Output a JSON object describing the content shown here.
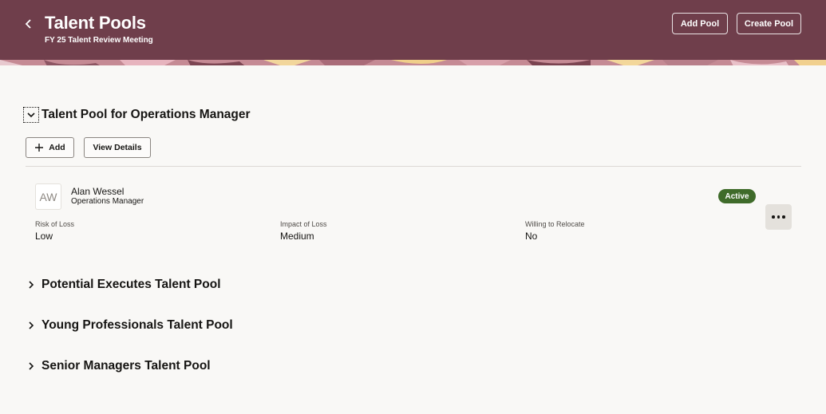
{
  "header": {
    "title": "Talent Pools",
    "subtitle": "FY 25 Talent Review Meeting",
    "add_pool_label": "Add Pool",
    "create_pool_label": "Create Pool",
    "back_icon": "chevron-left-icon",
    "background_color": "#6f3e4b"
  },
  "expanded_pool": {
    "title": "Talent Pool for Operations Manager",
    "add_label": "Add",
    "view_details_label": "View Details",
    "member": {
      "initials": "AW",
      "name": "Alan Wessel",
      "role": "Operations Manager",
      "status": "Active",
      "status_color": "#3f6b2a",
      "attributes": [
        {
          "label": "Risk of Loss",
          "value": "Low"
        },
        {
          "label": "Impact of Loss",
          "value": "Medium"
        },
        {
          "label": "Willing to Relocate",
          "value": "No"
        }
      ]
    }
  },
  "collapsed_pools": [
    {
      "title": "Potential Executes Talent Pool"
    },
    {
      "title": "Young Professionals Talent Pool"
    },
    {
      "title": "Senior Managers Talent Pool"
    }
  ]
}
